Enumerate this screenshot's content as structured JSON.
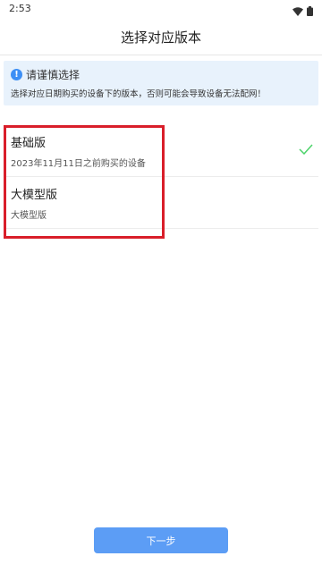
{
  "status": {
    "time": "2:53"
  },
  "header": {
    "title": "选择对应版本"
  },
  "notice": {
    "icon_symbol": "!",
    "title": "请谨慎选择",
    "desc": "选择对应日期购买的设备下的版本，否则可能会导致设备无法配网！"
  },
  "options": [
    {
      "title": "基础版",
      "subtitle": "2023年11月11日之前购买的设备",
      "selected": true
    },
    {
      "title": "大模型版",
      "subtitle": "大模型版",
      "selected": false
    }
  ],
  "footer": {
    "next_label": "下一步"
  },
  "colors": {
    "accent": "#5c9df5",
    "check": "#4cd36a",
    "highlight": "#d91e2a",
    "notice_bg": "#e8f2fc"
  }
}
